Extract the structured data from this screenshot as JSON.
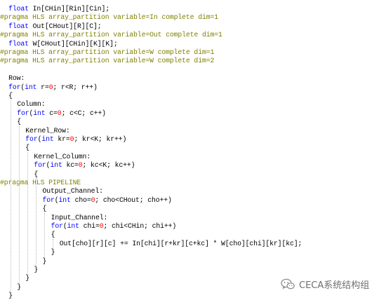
{
  "code_lines": [
    {
      "indent": 2,
      "parts": [
        [
          "kw",
          "float"
        ],
        [
          "t",
          " In[CHin][Rin][Cin];"
        ]
      ]
    },
    {
      "indent": 0,
      "parts": [
        [
          "prag",
          "#pragma HLS array_partition variable=In complete dim=1"
        ]
      ]
    },
    {
      "indent": 2,
      "parts": [
        [
          "kw",
          "float"
        ],
        [
          "t",
          " Out[CHout][R][C];"
        ]
      ]
    },
    {
      "indent": 0,
      "parts": [
        [
          "prag",
          "#pragma HLS array_partition variable=Out complete dim=1"
        ]
      ]
    },
    {
      "indent": 2,
      "parts": [
        [
          "kw",
          "float"
        ],
        [
          "t",
          " W[CHout][CHin][K][K];"
        ]
      ]
    },
    {
      "indent": 0,
      "parts": [
        [
          "prag",
          "#pragma HLS array_partition variable=W complete dim=1"
        ]
      ]
    },
    {
      "indent": 0,
      "parts": [
        [
          "prag",
          "#pragma HLS array_partition variable=W complete dim=2"
        ]
      ]
    },
    {
      "indent": 0,
      "parts": []
    },
    {
      "indent": 2,
      "parts": [
        [
          "t",
          "Row:"
        ]
      ]
    },
    {
      "indent": 2,
      "parts": [
        [
          "kw",
          "for"
        ],
        [
          "t",
          "("
        ],
        [
          "kw",
          "int"
        ],
        [
          "t",
          " r="
        ],
        [
          "num",
          "0"
        ],
        [
          "t",
          "; r<R; r++)"
        ]
      ]
    },
    {
      "indent": 2,
      "parts": [
        [
          "t",
          "{"
        ]
      ]
    },
    {
      "indent": 4,
      "parts": [
        [
          "t",
          "Column:"
        ]
      ]
    },
    {
      "indent": 4,
      "parts": [
        [
          "kw",
          "for"
        ],
        [
          "t",
          "("
        ],
        [
          "kw",
          "int"
        ],
        [
          "t",
          " c="
        ],
        [
          "num",
          "0"
        ],
        [
          "t",
          "; c<C; c++)"
        ]
      ]
    },
    {
      "indent": 4,
      "parts": [
        [
          "t",
          "{"
        ]
      ]
    },
    {
      "indent": 6,
      "parts": [
        [
          "t",
          "Kernel_Row:"
        ]
      ]
    },
    {
      "indent": 6,
      "parts": [
        [
          "kw",
          "for"
        ],
        [
          "t",
          "("
        ],
        [
          "kw",
          "int"
        ],
        [
          "t",
          " kr="
        ],
        [
          "num",
          "0"
        ],
        [
          "t",
          "; kr<K; kr++)"
        ]
      ]
    },
    {
      "indent": 6,
      "parts": [
        [
          "t",
          "{"
        ]
      ]
    },
    {
      "indent": 8,
      "parts": [
        [
          "t",
          "Kernel_Column:"
        ]
      ]
    },
    {
      "indent": 8,
      "parts": [
        [
          "kw",
          "for"
        ],
        [
          "t",
          "("
        ],
        [
          "kw",
          "int"
        ],
        [
          "t",
          " kc="
        ],
        [
          "num",
          "0"
        ],
        [
          "t",
          "; kc<K; kc++)"
        ]
      ]
    },
    {
      "indent": 8,
      "parts": [
        [
          "t",
          "{"
        ]
      ]
    },
    {
      "indent": 0,
      "parts": [
        [
          "prag",
          "#pragma HLS PIPELINE"
        ]
      ]
    },
    {
      "indent": 10,
      "parts": [
        [
          "t",
          "Output_Channel:"
        ]
      ]
    },
    {
      "indent": 10,
      "parts": [
        [
          "kw",
          "for"
        ],
        [
          "t",
          "("
        ],
        [
          "kw",
          "int"
        ],
        [
          "t",
          " cho="
        ],
        [
          "num",
          "0"
        ],
        [
          "t",
          "; cho<CHout; cho++)"
        ]
      ]
    },
    {
      "indent": 10,
      "parts": [
        [
          "t",
          "{"
        ]
      ]
    },
    {
      "indent": 12,
      "parts": [
        [
          "t",
          "Input_Channel:"
        ]
      ]
    },
    {
      "indent": 12,
      "parts": [
        [
          "kw",
          "for"
        ],
        [
          "t",
          "("
        ],
        [
          "kw",
          "int"
        ],
        [
          "t",
          " chi="
        ],
        [
          "num",
          "0"
        ],
        [
          "t",
          "; chi<CHin; chi++)"
        ]
      ]
    },
    {
      "indent": 12,
      "parts": [
        [
          "t",
          "{"
        ]
      ]
    },
    {
      "indent": 14,
      "parts": [
        [
          "t",
          "Out[cho][r][c] += In[chi][r+kr][c+kc] * W[cho][chi][kr][kc];"
        ]
      ]
    },
    {
      "indent": 12,
      "parts": [
        [
          "t",
          "}"
        ]
      ]
    },
    {
      "indent": 10,
      "parts": [
        [
          "t",
          "}"
        ]
      ]
    },
    {
      "indent": 8,
      "parts": [
        [
          "t",
          "}"
        ]
      ]
    },
    {
      "indent": 6,
      "parts": [
        [
          "t",
          "}"
        ]
      ]
    },
    {
      "indent": 4,
      "parts": [
        [
          "t",
          "}"
        ]
      ]
    },
    {
      "indent": 2,
      "parts": [
        [
          "t",
          "}"
        ]
      ]
    }
  ],
  "colors": {
    "keyword": "#0000ff",
    "pragma": "#808000",
    "number": "#ff0000",
    "text": "#000000",
    "watermark": "#6f6f6f"
  },
  "watermark": {
    "icon": "wechat-icon",
    "text": "CECA系统结构组"
  }
}
